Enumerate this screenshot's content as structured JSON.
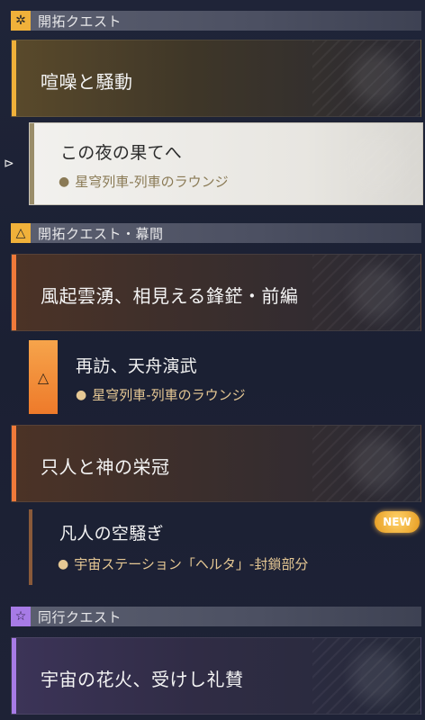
{
  "sections": [
    {
      "title": "開拓クエスト",
      "icon": "compass-icon"
    },
    {
      "title": "開拓クエスト・幕間",
      "icon": "triangle-star-icon"
    },
    {
      "title": "同行クエスト",
      "icon": "star-icon"
    }
  ],
  "quests": {
    "main1": {
      "label": "喧噪と騒動",
      "accent": "#f0b13a"
    },
    "sub1": {
      "title": "この夜の果てへ",
      "location": "星穹列車-列車のラウンジ"
    },
    "inter1": {
      "label": "風起雲湧、相見える鋒鋩・前編",
      "accent": "#f07a3a"
    },
    "sub2": {
      "title": "再訪、天舟演武",
      "location": "星穹列車-列車のラウンジ"
    },
    "inter2": {
      "label": "只人と神の栄冠",
      "accent": "#f07a3a"
    },
    "sub3": {
      "title": "凡人の空騒ぎ",
      "location": "宇宙ステーション「ヘルタ」-封鎖部分",
      "badge": "NEW"
    },
    "comp1": {
      "label": "宇宙の花火、受けし礼賛",
      "accent": "#a77be6"
    }
  }
}
